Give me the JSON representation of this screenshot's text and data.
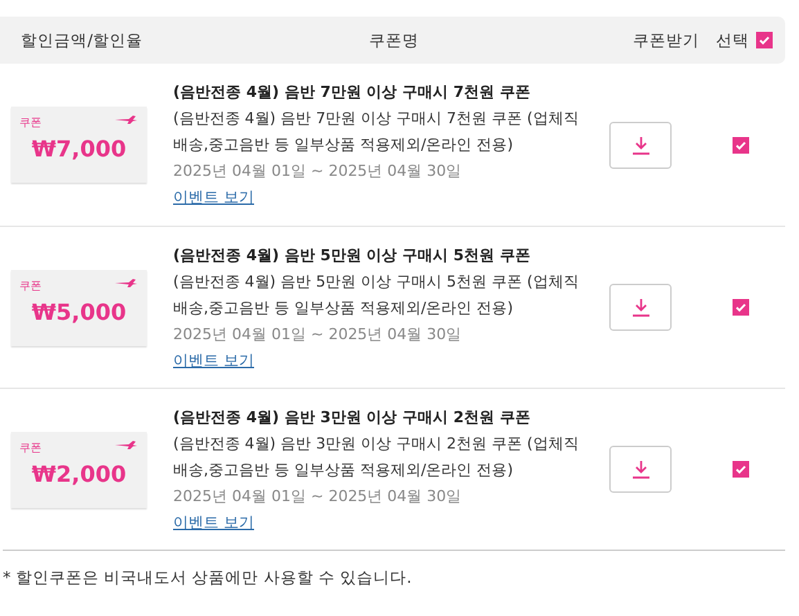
{
  "header": {
    "columns": [
      "할인금액/할인율",
      "쿠폰명",
      "쿠폰받기",
      "선택"
    ],
    "select_all": {
      "checked": true
    }
  },
  "coupons": [
    {
      "label": "쿠폰",
      "amount": "₩7,000",
      "title": "(음반전종 4월) 음반 7만원 이상 구매시 7천원 쿠폰",
      "description": "(음반전종 4월) 음반 7만원 이상 구매시 7천원 쿠폰 (업체직배송,중고음반 등 일부상품 적용제외/온라인 전용)",
      "period": "2025년 04월 01일 ~ 2025년 04월 30일",
      "link": "이벤트 보기",
      "checked": true
    },
    {
      "label": "쿠폰",
      "amount": "₩5,000",
      "title": "(음반전종 4월) 음반 5만원 이상 구매시 5천원 쿠폰",
      "description": "(음반전종 4월) 음반 5만원 이상 구매시 5천원 쿠폰 (업체직배송,중고음반 등 일부상품 적용제외/온라인 전용)",
      "period": "2025년 04월 01일 ~ 2025년 04월 30일",
      "link": "이벤트 보기",
      "checked": true
    },
    {
      "label": "쿠폰",
      "amount": "₩2,000",
      "title": "(음반전종 4월) 음반 3만원 이상 구매시 2천원 쿠폰",
      "description": "(음반전종 4월) 음반 3만원 이상 구매시 2천원 쿠폰 (업체직배송,중고음반 등 일부상품 적용제외/온라인 전용)",
      "period": "2025년 04월 01일 ~ 2025년 04월 30일",
      "link": "이벤트 보기",
      "checked": true
    }
  ],
  "note": "* 할인쿠폰은 비국내도서 상품에만 사용할 수 있습니다."
}
